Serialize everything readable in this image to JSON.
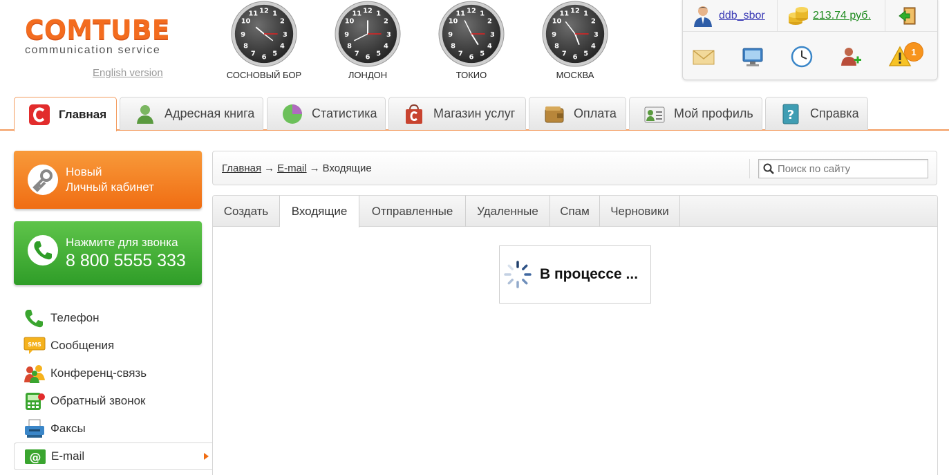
{
  "logo": {
    "word": "COMTUBE",
    "tagline": "communication service"
  },
  "english_link": "English version",
  "clocks": [
    {
      "city": "СОСНОВЫЙ БОР"
    },
    {
      "city": "ЛОНДОН"
    },
    {
      "city": "ТОКИО"
    },
    {
      "city": "МОСКВА"
    }
  ],
  "account": {
    "username": "ddb_sbor",
    "balance": "213.74 руб.",
    "icons": [
      "mail-icon",
      "monitor-icon",
      "clock-icon",
      "add-user-icon",
      "warning-icon"
    ],
    "notification_count": "1"
  },
  "nav_tabs": [
    {
      "label": "Главная",
      "icon": "comtube-icon",
      "active": true
    },
    {
      "label": "Адресная книга",
      "icon": "address-book-icon",
      "active": false
    },
    {
      "label": "Статистика",
      "icon": "pie-chart-icon",
      "active": false
    },
    {
      "label": "Магазин услуг",
      "icon": "shopping-bag-icon",
      "active": false
    },
    {
      "label": "Оплата",
      "icon": "wallet-icon",
      "active": false
    },
    {
      "label": "Мой профиль",
      "icon": "profile-card-icon",
      "active": false
    },
    {
      "label": "Справка",
      "icon": "help-book-icon",
      "active": false
    }
  ],
  "promo": {
    "cabinet_line1": "Новый",
    "cabinet_line2": "Личный кабинет",
    "call_label": "Нажмите для звонка",
    "call_number": "8 800 5555 333"
  },
  "menu": [
    {
      "label": "Телефон",
      "icon": "phone-icon"
    },
    {
      "label": "Сообщения",
      "icon": "sms-icon"
    },
    {
      "label": "Конференц-связь",
      "icon": "conference-icon"
    },
    {
      "label": "Обратный звонок",
      "icon": "callback-icon"
    },
    {
      "label": "Факсы",
      "icon": "fax-icon"
    },
    {
      "label": "E-mail",
      "icon": "email-icon",
      "active": true
    }
  ],
  "breadcrumb": {
    "home": "Главная",
    "section": "E-mail",
    "current": "Входящие",
    "separator": "→"
  },
  "search": {
    "placeholder": "Поиск по сайту"
  },
  "mail_tabs": [
    {
      "label": "Создать"
    },
    {
      "label": "Входящие",
      "active": true
    },
    {
      "label": "Отправленные"
    },
    {
      "label": "Удаленные"
    },
    {
      "label": "Спам"
    },
    {
      "label": "Черновики"
    }
  ],
  "loading_text": "В процессе ...",
  "colors": {
    "brand_orange": "#f36c1f",
    "green": "#3aa52f",
    "link_green": "#1c8a1c",
    "link_blue": "#3a3ab5"
  }
}
